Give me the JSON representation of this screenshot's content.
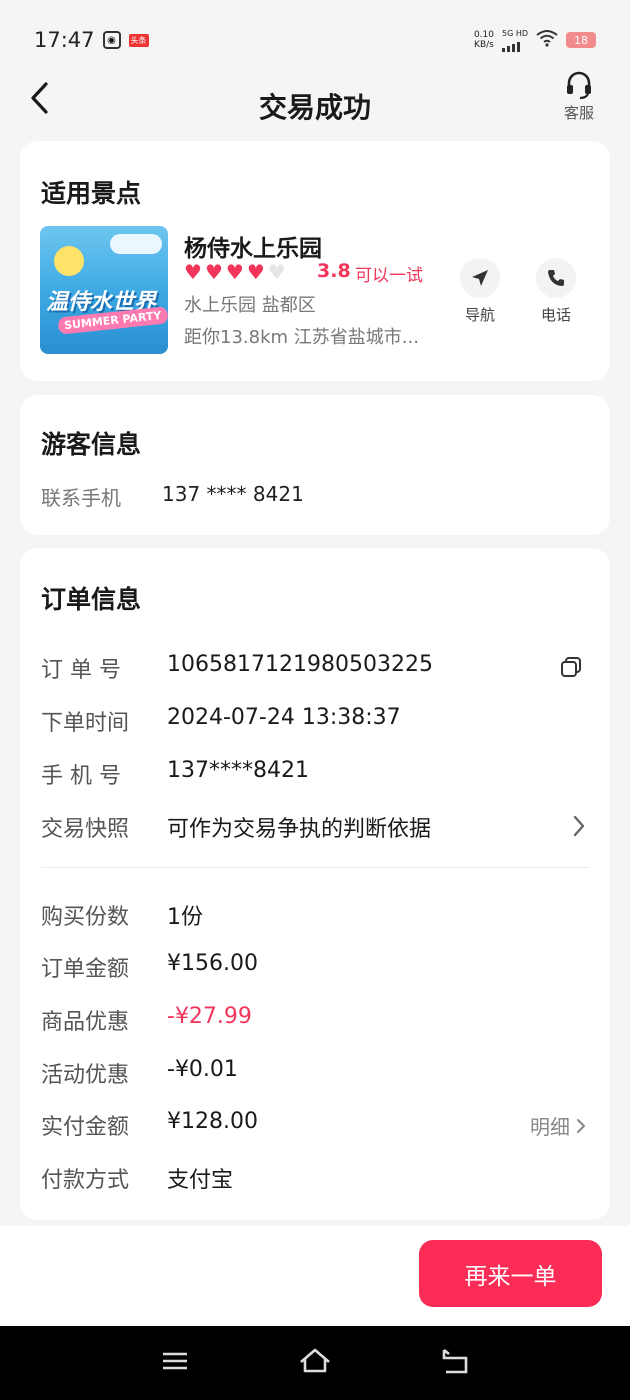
{
  "status_bar": {
    "time": "17:47",
    "app_badge": "头条",
    "net_speed": "0.10",
    "net_unit": "KB/s",
    "network": "5G HD",
    "battery": "18"
  },
  "nav": {
    "title": "交易成功",
    "service_label": "客服"
  },
  "scenic": {
    "section_title": "适用景点",
    "image_text_main": "温侍水世界",
    "image_text_sub": "SUMMER PARTY",
    "name": "杨侍水上乐园",
    "rating": "3.8",
    "rating_hearts_filled": 4,
    "rating_hearts_total": 5,
    "rating_text": "可以一试",
    "type_area": "水上乐园 盐都区",
    "distance_address": "距你13.8km  江苏省盐城市...",
    "nav_label": "导航",
    "phone_label": "电话"
  },
  "guest": {
    "section_title": "游客信息",
    "phone_label": "联系手机",
    "phone_value": "137 **** 8421"
  },
  "order": {
    "section_title": "订单信息",
    "order_no_label": "订 单 号",
    "order_no_value": "1065817121980503225",
    "time_label": "下单时间",
    "time_value": "2024-07-24 13:38:37",
    "phone_label": "手 机 号",
    "phone_value": "137****8421",
    "snapshot_label": "交易快照",
    "snapshot_value": "可作为交易争执的判断依据",
    "qty_label": "购买份数",
    "qty_value": "1份",
    "amount_label": "订单金额",
    "amount_value": "¥156.00",
    "goods_discount_label": "商品优惠",
    "goods_discount_value": "-¥27.99",
    "activity_discount_label": "活动优惠",
    "activity_discount_value": "-¥0.01",
    "paid_label": "实付金额",
    "paid_value": "¥128.00",
    "detail_label": "明细",
    "pay_method_label": "付款方式",
    "pay_method_value": "支付宝"
  },
  "footer": {
    "again_label": "再来一单"
  },
  "colors": {
    "accent": "#fb2c55",
    "discount": "#f2355b"
  }
}
